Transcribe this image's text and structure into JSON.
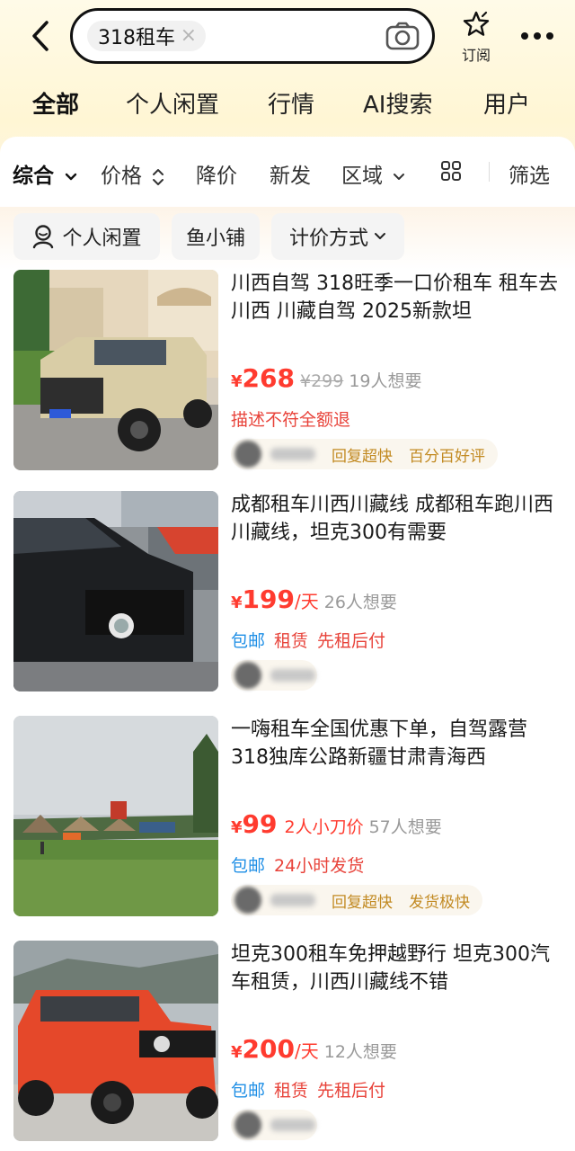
{
  "search": {
    "query": "318租车"
  },
  "header": {
    "subscribe_label": "订阅"
  },
  "category_tabs": [
    "全部",
    "个人闲置",
    "行情",
    "AI搜索",
    "用户"
  ],
  "filters": [
    "综合",
    "价格",
    "降价",
    "新发",
    "区域",
    "筛选"
  ],
  "chips": [
    "个人闲置",
    "鱼小铺",
    "计价方式"
  ],
  "colors": {
    "price": "#ff3b2f",
    "tag_red": "#e8433a",
    "tag_blue": "#1f8fe6",
    "seller_tag": "#c28a22",
    "highlight": "#ffe14d"
  },
  "listings": [
    {
      "title": "川西自驾 318旺季一口价租车 租车去川西 川藏自驾 2025新款坦",
      "currency": "¥",
      "price": "268",
      "unit": "",
      "original_price": "¥299",
      "bargain": "",
      "wants": "19人想要",
      "tags": [
        {
          "text": "描述不符全额退",
          "color": "red"
        }
      ],
      "seller_tags": [
        "回复超快",
        "百分百好评"
      ]
    },
    {
      "title": "成都租车川西川藏线 成都租车跑川西川藏线，坦克300有需要",
      "currency": "¥",
      "price": "199",
      "unit": "/天",
      "original_price": "",
      "bargain": "",
      "wants": "26人想要",
      "tags": [
        {
          "text": "包邮",
          "color": "blue"
        },
        {
          "text": "租赁",
          "color": "red"
        },
        {
          "text": "先租后付",
          "color": "red"
        }
      ],
      "seller_tags": []
    },
    {
      "title": "一嗨租车全国优惠下单，自驾露营318独库公路新疆甘肃青海西",
      "currency": "¥",
      "price": "99",
      "unit": "",
      "original_price": "",
      "bargain": "2人小刀价",
      "wants": "57人想要",
      "tags": [
        {
          "text": "包邮",
          "color": "blue"
        },
        {
          "text": "24小时发货",
          "color": "red"
        }
      ],
      "seller_tags": [
        "回复超快",
        "发货极快"
      ]
    },
    {
      "title": "坦克300租车免押越野行 坦克300汽车租赁，川西川藏线不错",
      "currency": "¥",
      "price": "200",
      "unit": "/天",
      "original_price": "",
      "bargain": "",
      "wants": "12人想要",
      "tags": [
        {
          "text": "包邮",
          "color": "blue"
        },
        {
          "text": "租赁",
          "color": "red"
        },
        {
          "text": "先租后付",
          "color": "red"
        }
      ],
      "seller_tags": []
    }
  ]
}
